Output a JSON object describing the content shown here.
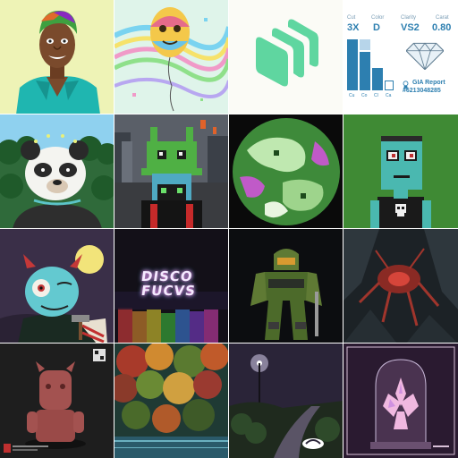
{
  "gallery": {
    "tiles": [
      {
        "name": "cartoon-man-teal-shirt"
      },
      {
        "name": "balloon-faces-rainbow"
      },
      {
        "name": "green-layers-logo"
      },
      {
        "name": "diamond-spec-card"
      },
      {
        "name": "panda-forest"
      },
      {
        "name": "pixel-octopus-ape"
      },
      {
        "name": "green-pixel-planet"
      },
      {
        "name": "pixel-teal-character"
      },
      {
        "name": "blue-devil-hammer"
      },
      {
        "name": "disco-neon-sign"
      },
      {
        "name": "green-armor-soldier"
      },
      {
        "name": "red-creature-cave"
      },
      {
        "name": "red-toy-figure"
      },
      {
        "name": "autumn-forest-river"
      },
      {
        "name": "night-path-streetlight"
      },
      {
        "name": "crystal-flower-bell-jar"
      }
    ]
  },
  "diamond_card": {
    "cut_label": "Cut",
    "cut_value": "3X",
    "color_label": "Color",
    "color_value": "D",
    "clarity_label": "Clarity",
    "clarity_value": "VS2",
    "carat_label": "Carat",
    "carat_value": "0.80",
    "axis_labels": [
      "Cu",
      "Co",
      "Cl",
      "Ca"
    ],
    "report_title": "GIA Report",
    "report_number": "#6213048285",
    "accent": "#2d7fb0"
  },
  "disco_sign": {
    "line1": "DISCO",
    "line2": "FUCVS"
  }
}
